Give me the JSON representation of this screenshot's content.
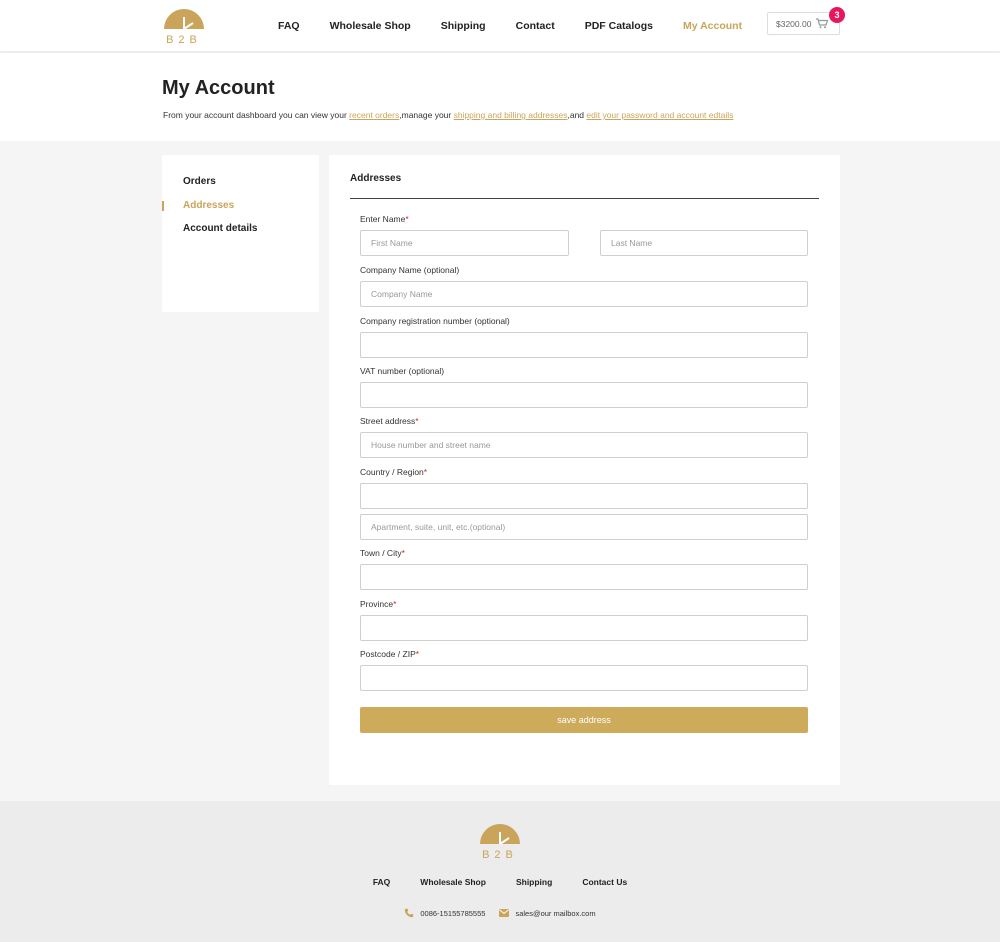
{
  "brand": {
    "logo_text": "B2B",
    "accent": "#c9a45a",
    "button_color": "#cdab5a",
    "badge_color": "#e8175d"
  },
  "nav": {
    "items": [
      "FAQ",
      "Wholesale Shop",
      "Shipping",
      "Contact",
      "PDF Catalogs",
      "My Account"
    ],
    "active": "My Account"
  },
  "cart": {
    "total": "$3200.00",
    "count": "3",
    "icon": "cart-icon"
  },
  "page": {
    "title": "My Account",
    "intro_1": "From your account dashboard you can view your ",
    "intro_link_1": "recent orders",
    "intro_2": ",manage your ",
    "intro_link_2": "shipping and billing addresses",
    "intro_3": ",and ",
    "intro_link_3": "edit your password and account edtails"
  },
  "sidebar": {
    "items": [
      "Orders",
      "Addresses",
      "Account details"
    ],
    "active": "Addresses"
  },
  "form": {
    "title": "Addresses",
    "name_label": "Enter Name",
    "first_name_placeholder": "First Name",
    "last_name_placeholder": "Last Name",
    "company_label": "Company Name (optional)",
    "company_placeholder": "Company Name",
    "reg_label": "Company registration number (optional)",
    "vat_label": "VAT number (optional)",
    "street_label": "Street address",
    "street_placeholder": "House number and street name",
    "country_label": "Country / Region",
    "apartment_placeholder": "Apartment, suite, unit, etc.(optional)",
    "city_label": "Town / City",
    "province_label": "Province",
    "postcode_label": "Postcode / ZIP",
    "required_mark": "*",
    "save_label": "save address"
  },
  "footer": {
    "logo_text": "B2B",
    "nav": [
      "FAQ",
      "Wholesale Shop",
      "Shipping",
      "Contact Us"
    ],
    "phone": "0086-15155785555",
    "email": "sales@our mailbox.com",
    "phone_icon": "phone-icon",
    "mail_icon": "mail-icon"
  }
}
